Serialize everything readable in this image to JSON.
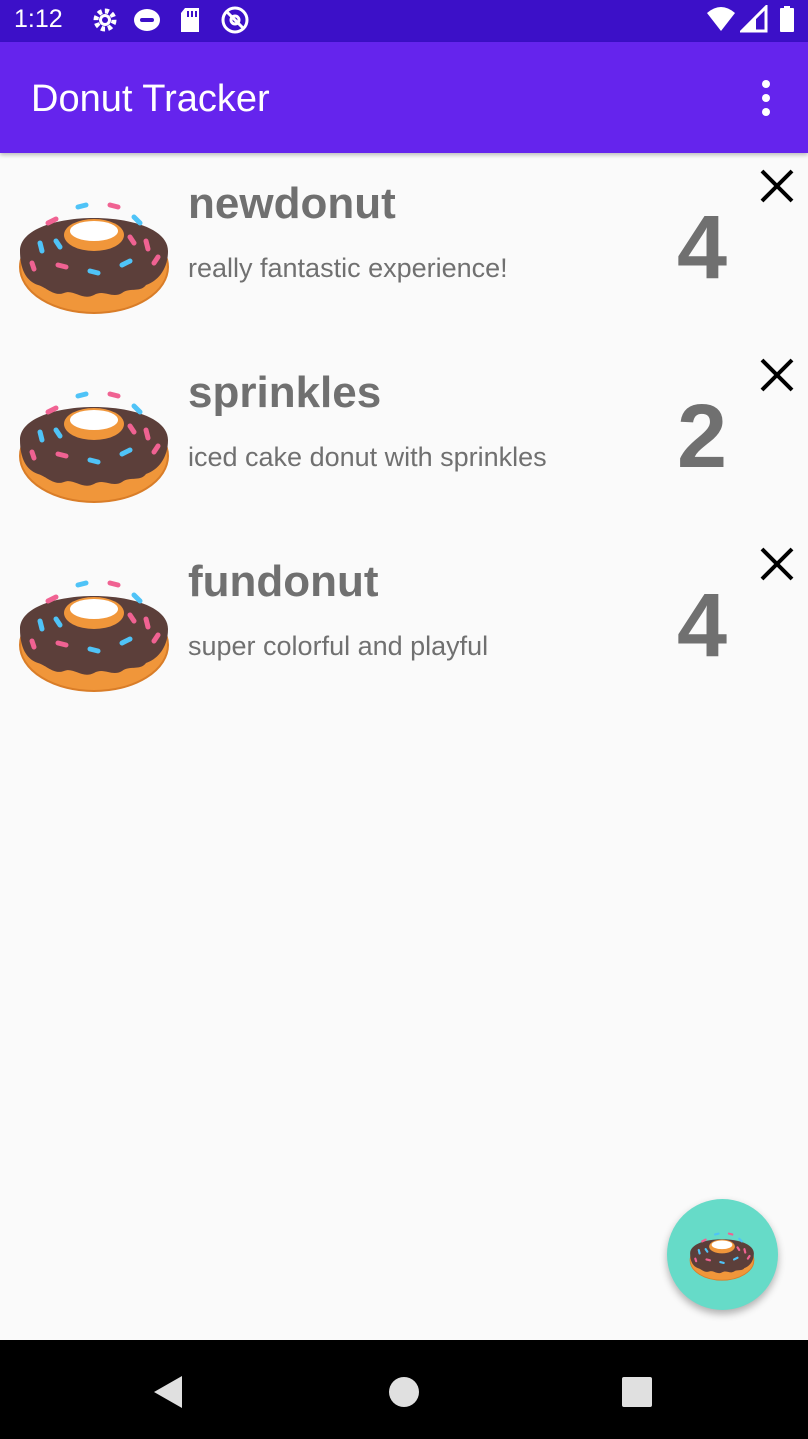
{
  "status_bar": {
    "time": "1:12",
    "icons_left": [
      "gear-icon",
      "alarm-icon",
      "sd-card-icon",
      "at-sign-icon"
    ],
    "icons_right": [
      "wifi-icon",
      "signal-icon",
      "battery-icon"
    ],
    "color": "#3c10c8"
  },
  "app_bar": {
    "title": "Donut Tracker",
    "color": "#6524ed",
    "overflow_icon": "more-vert-icon"
  },
  "donuts": [
    {
      "name": "newdonut",
      "description": "really fantastic experience!",
      "rating": "4"
    },
    {
      "name": "sprinkles",
      "description": "iced cake donut with sprinkles",
      "rating": "2"
    },
    {
      "name": "fundonut",
      "description": "super colorful and playful",
      "rating": "4"
    }
  ],
  "fab": {
    "icon": "donut-icon",
    "color": "#66dbc8"
  },
  "nav_bar": {
    "buttons": [
      "back-icon",
      "home-icon",
      "recents-icon"
    ]
  }
}
